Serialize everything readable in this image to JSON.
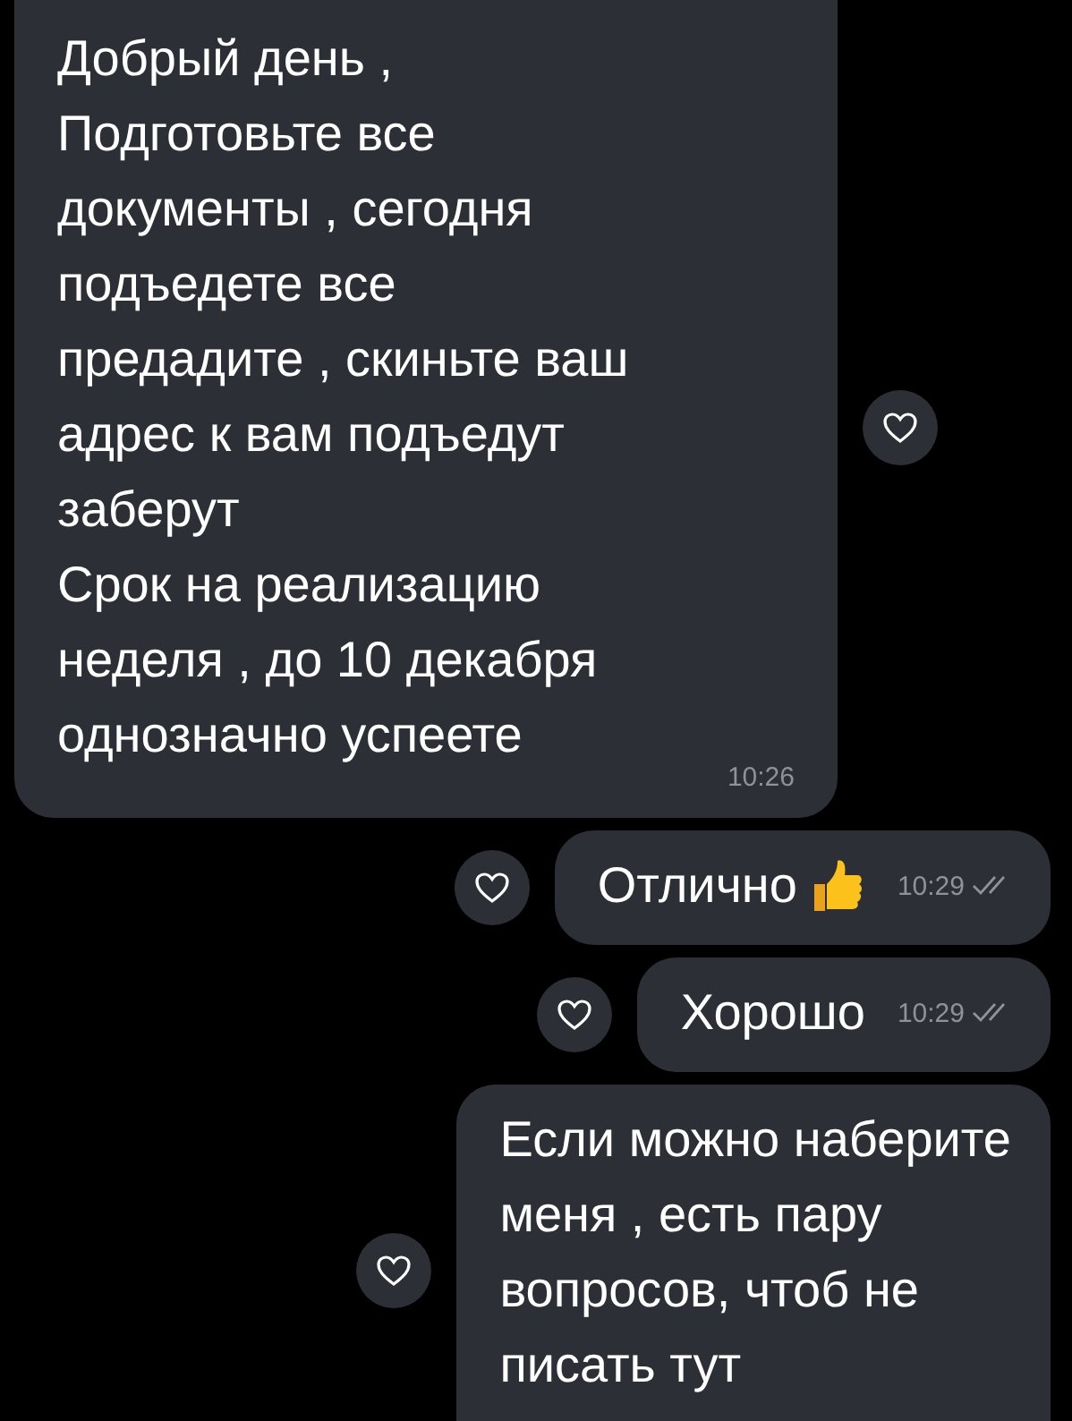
{
  "messages": [
    {
      "kind": "incoming",
      "text": "Добрый день ,\nПодготовьте все\nдокументы , сегодня\nподъедете все\nпредадите , скиньте ваш\nадрес к вам подъедут\nзаберут\nСрок на реализацию\nнеделя , до 10 декабря\nоднозначно успеете",
      "time": "10:26"
    },
    {
      "kind": "outgoing",
      "text": "Отлично",
      "thumbs_up": true,
      "time": "10:29",
      "read": true
    },
    {
      "kind": "outgoing",
      "text": "Хорошо",
      "time": "10:29",
      "read": true
    },
    {
      "kind": "outgoing",
      "text": "Если можно наберите\nменя , есть пару\nвопросов, чтоб не\nписать тут"
    }
  ]
}
